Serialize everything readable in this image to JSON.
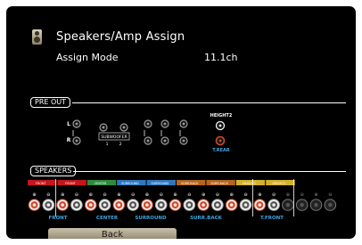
{
  "header": {
    "icon": "speaker-icon",
    "title": "Speakers/Amp Assign",
    "assign_mode_label": "Assign Mode",
    "assign_mode_value": "11.1ch"
  },
  "preout": {
    "section_label": "PRE OUT",
    "left_label": "L",
    "right_label": "R",
    "subwoofer_label": "SUBWOOFER",
    "subwoofer_channels": [
      "1",
      "2"
    ],
    "height2_label": "HEIGHT2",
    "height2_assign": "T.REAR"
  },
  "speakers": {
    "section_label": "SPEAKERS",
    "bars": [
      "FRONT",
      "FRONT",
      "CENTER",
      "SURROUND",
      "SURROUND",
      "SURR.BACK",
      "SURR.BACK",
      "HEIGHT1",
      "HEIGHT1"
    ],
    "polarity": [
      "⊕",
      "⊖"
    ],
    "assign_labels": [
      "FRONT",
      "CENTER",
      "SURROUND",
      "SURR.BACK",
      "T.FRONT"
    ]
  },
  "colors": {
    "background": "#000000",
    "assign_text": "#3da5e0",
    "red_terminal": "#d14a2c",
    "bar_front": "#c4161c",
    "bar_center": "#2e8b3e",
    "bar_surround": "#2c79c0",
    "bar_surr_back": "#b5651d",
    "bar_height1": "#d4b22a"
  },
  "back_button": {
    "label": "Back"
  }
}
